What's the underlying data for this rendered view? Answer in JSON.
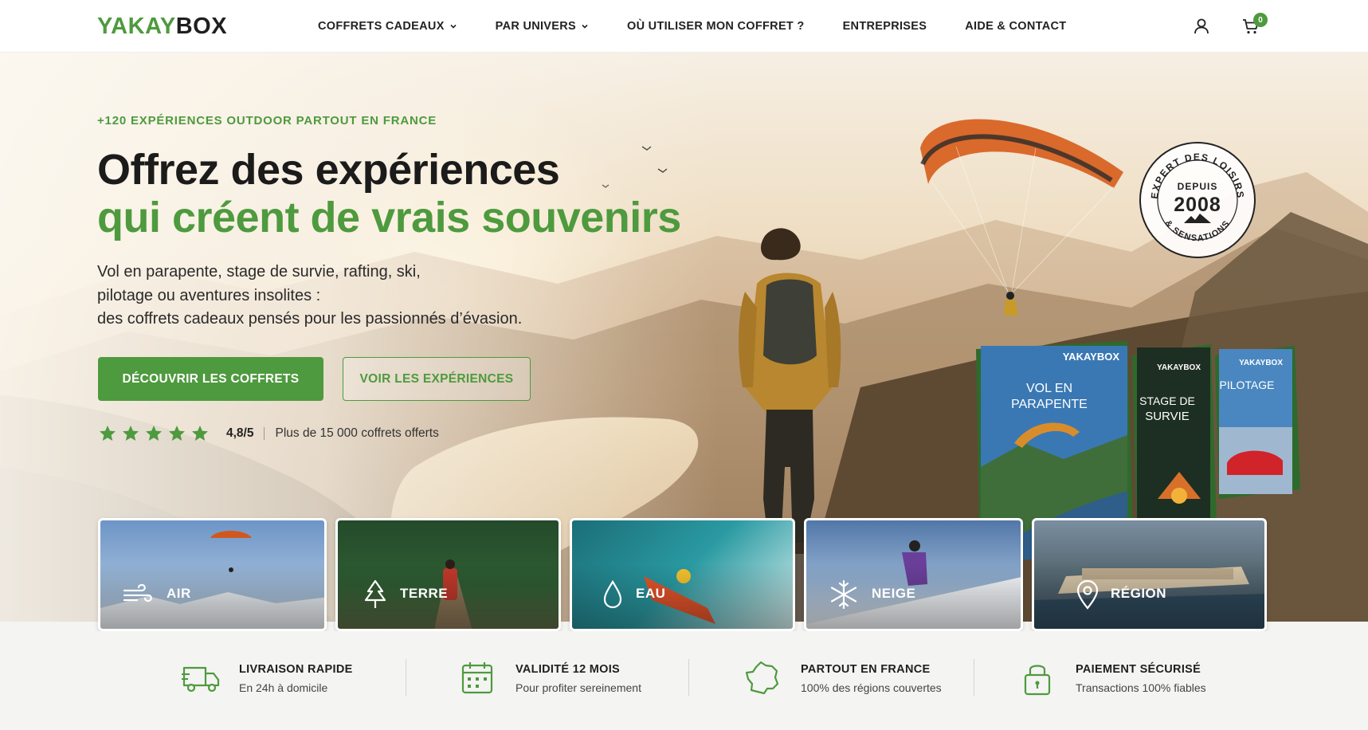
{
  "brand": {
    "logo_green": "YAKAY",
    "logo_dark": "BOX",
    "accent": "#4e9a3e"
  },
  "nav": [
    {
      "label": "COFFRETS CADEAUX",
      "dropdown": true
    },
    {
      "label": "PAR UNIVERS",
      "dropdown": true
    },
    {
      "label": "OÙ UTILISER MON COFFRET ?",
      "dropdown": false
    },
    {
      "label": "ENTREPRISES",
      "dropdown": false
    },
    {
      "label": "AIDE & CONTACT",
      "dropdown": false
    }
  ],
  "header_icons": {
    "account": "user-icon",
    "cart": "cart-icon",
    "cart_count": "0"
  },
  "hero": {
    "eyebrow": "+120 EXPÉRIENCES OUTDOOR PARTOUT EN FRANCE",
    "title_line1": "Offrez des expériences",
    "title_line2": "qui créent de vrais souvenirs",
    "desc_line1": "Vol en parapente, stage de survie, rafting, ski,",
    "desc_line2": "pilotage ou aventures insolites :",
    "desc_line3": "des coffrets cadeaux pensés pour les passionnés d’évasion.",
    "cta_primary": "DÉCOUVRIR LES COFFRETS",
    "cta_secondary": "VOIR LES EXPÉRIENCES",
    "rating_stars": 5,
    "rating_value": "4,8/5",
    "rating_note": "Plus de 15 000 coffrets offerts"
  },
  "seal": {
    "arc_top": "EXPERT DES LOISIRS",
    "small": "DEPUIS",
    "year": "2008",
    "arc_bottom": "& SENSATIONS"
  },
  "boxes": [
    {
      "brand": "YAKAYBOX",
      "title_l1": "VOL EN",
      "title_l2": "PARAPENTE"
    },
    {
      "brand": "YAKAYBOX",
      "title_l1": "STAGE DE",
      "title_l2": "SURVIE"
    },
    {
      "brand": "YAKAYBOX",
      "title_l1": "PILOTAGE",
      "title_l2": ""
    }
  ],
  "categories": [
    {
      "label": "AIR",
      "icon": "wind-icon"
    },
    {
      "label": "TERRE",
      "icon": "tree-icon"
    },
    {
      "label": "EAU",
      "icon": "water-drop-icon"
    },
    {
      "label": "NEIGE",
      "icon": "snowflake-icon"
    },
    {
      "label": "RÉGION",
      "icon": "location-pin-icon"
    }
  ],
  "features": [
    {
      "title": "LIVRAISON RAPIDE",
      "subtitle": "En 24h à domicile",
      "icon": "truck-icon"
    },
    {
      "title": "VALIDITÉ 12 MOIS",
      "subtitle": "Pour profiter sereinement",
      "icon": "calendar-icon"
    },
    {
      "title": "PARTOUT EN FRANCE",
      "subtitle": "100% des régions couvertes",
      "icon": "france-map-icon"
    },
    {
      "title": "PAIEMENT SÉCURISÉ",
      "subtitle": "Transactions 100% fiables",
      "icon": "lock-icon"
    }
  ]
}
